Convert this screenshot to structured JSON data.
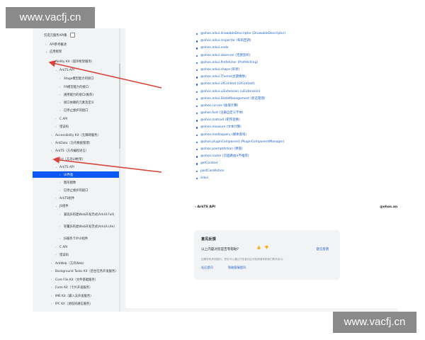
{
  "watermark": {
    "text": "www.vacfj.cn",
    "color": "#8a8a8a"
  },
  "sidebar": {
    "filter_label": "仅选元服务API集",
    "items": [
      {
        "label": "API参考概述",
        "chev": "›"
      },
      {
        "label": "应用框架",
        "chev": "⌄"
      },
      {
        "label": "Ability Kit（程序框架服务）",
        "chev": "⌄"
      },
      {
        "label": "ArkTS API",
        "chev": "⌄"
      },
      {
        "label": "Stage模型能力的接口",
        "chev": "›"
      },
      {
        "label": "FA模型能力的接口",
        "chev": "›"
      },
      {
        "label": "通用能力的接口(推荐)",
        "chev": "›"
      },
      {
        "label": "接口依赖的元素及定义",
        "chev": "›"
      },
      {
        "label": "已停止维护的接口",
        "chev": "›"
      },
      {
        "label": "C API",
        "chev": "›"
      },
      {
        "label": "错误码",
        "chev": "›"
      },
      {
        "label": "Accessibility Kit（无障碍服务）",
        "chev": "›"
      },
      {
        "label": "ArkData（方舟数据管理）",
        "chev": "›"
      },
      {
        "label": "ArkTS（方舟编程语言）",
        "chev": "›"
      },
      {
        "label": "ArkUI（方舟UI框架）",
        "chev": "⌄"
      },
      {
        "label": "ArkTS API",
        "chev": "⌄"
      },
      {
        "label": "UI界面",
        "chev": "›"
      },
      {
        "label": "图形图像",
        "chev": "›"
      },
      {
        "label": "已停止维护的接口",
        "chev": "›"
      },
      {
        "label": "ArkTS组件",
        "chev": "›"
      },
      {
        "label": "JS组件",
        "chev": "⌄"
      },
      {
        "label": "兼容JS的类Web开发范式(ArkUI.Full)",
        "chev": "›"
      },
      {
        "label": "轻量JS的类Web开发范式(ArkUI.Lite)",
        "chev": "›"
      },
      {
        "label": "JS服务卡片UI组件",
        "chev": "›"
      },
      {
        "label": "C API",
        "chev": "›"
      },
      {
        "label": "错误码",
        "chev": "›"
      },
      {
        "label": "ArkWeb（方舟Web）",
        "chev": "›"
      },
      {
        "label": "Background Tasks Kit（后台任务开发服务）",
        "chev": "›"
      },
      {
        "label": "Core File Kit（文件基础服务）",
        "chev": "›"
      },
      {
        "label": "Form Kit（卡片开发服务）",
        "chev": "›"
      },
      {
        "label": "IME Kit（输入法开发服务）",
        "chev": "›"
      },
      {
        "label": "IPC Kit（进程间通信服务）",
        "chev": "›"
      }
    ],
    "active_index": 16
  },
  "api_list": [
    "@ohos.arkui.drawableDescriptor (DrawableDescriptor)",
    "@ohos.arkui.inspector (布局回调)",
    "@ohos.arkui.node",
    "@ohos.arkui.observer (无感监听)",
    "@ohos.arkui.Prefetcher (Prefetching)",
    "@ohos.arkui.shape (形状)",
    "@ohos.arkui.Theme(主题换肤)",
    "@ohos.arkui.UIContext (UIContext)",
    "@ohos.arkui.uiExtension (uiExtension)",
    "@ohos.arkui.StateManagement (状态管理)",
    "@ohos.curves (插值计算)",
    "@ohos.font (注册自定义字体)",
    "@ohos.matrix4 (矩阵变换)",
    "@ohos.measure (文本计算)",
    "@ohos.mediaquery (媒体查询)",
    "@ohos.pluginComponent (PluginComponentManager)",
    "@ohos.promptAction (弹窗)",
    "@ohos.router (页面路由)(不推荐)",
    "getContext",
    "postCardAction",
    "arkui"
  ],
  "pager": {
    "prev": "ArkTS API",
    "next": "@ohos.anir"
  },
  "feedback": {
    "title": "意见反馈",
    "question": "以上内容对您是否有帮助?",
    "suggest": "意见反馈",
    "desc": "如果您有其他疑问，您也可以通过开发者社区问答频道来和我们联系探讨。",
    "link1": "社区提问",
    "link2": "智能客服提问"
  },
  "colors": {
    "accent": "#0a59f7",
    "link": "#1a5fc7",
    "annotation_arrow": "#d9433a"
  }
}
